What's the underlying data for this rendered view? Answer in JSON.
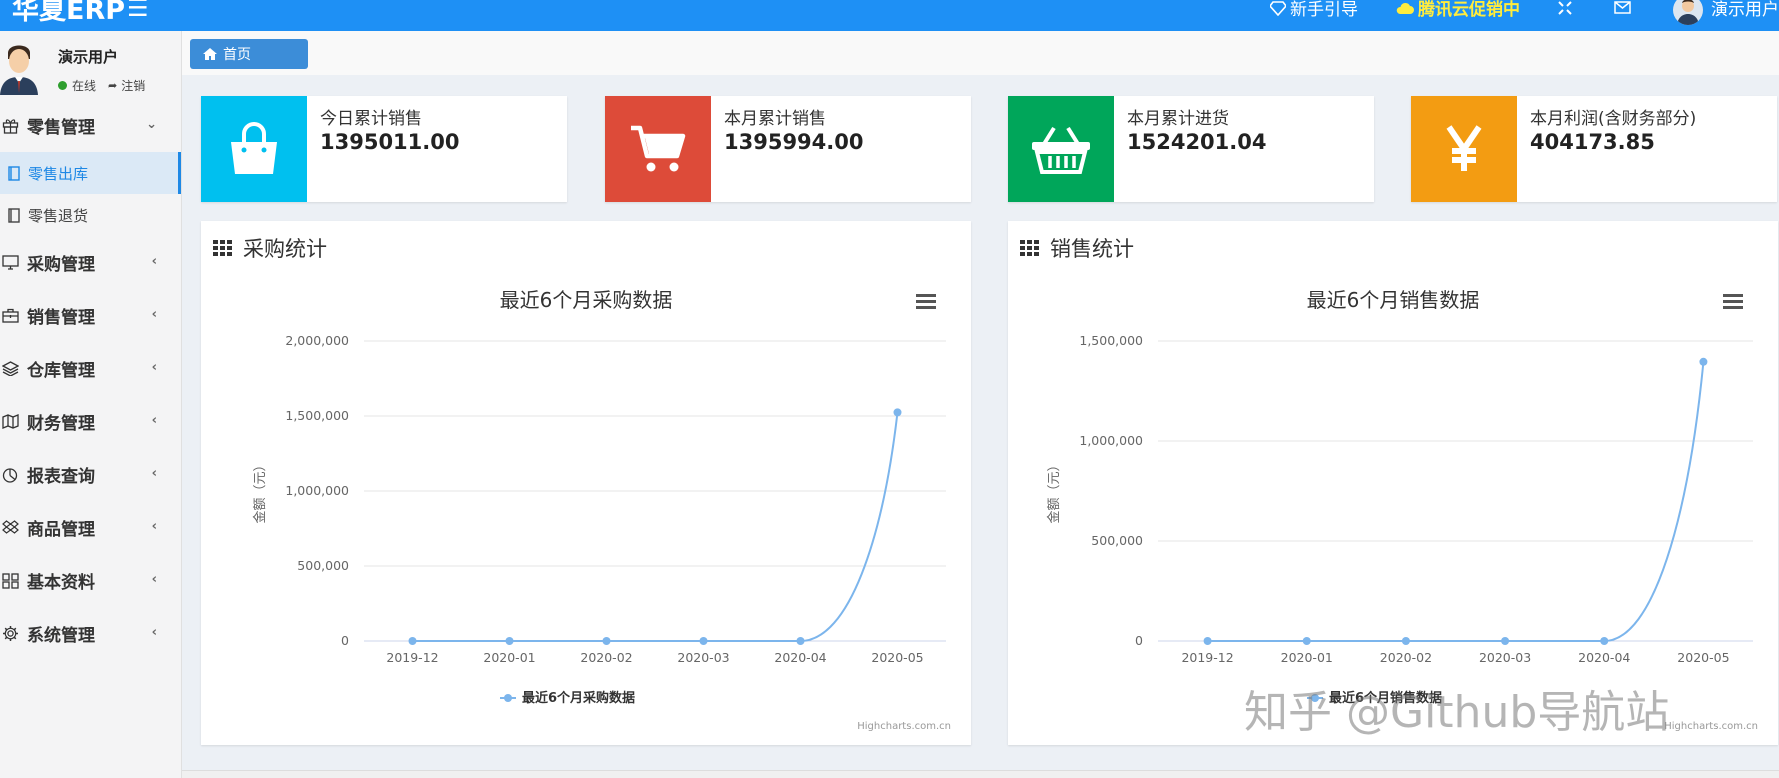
{
  "app": {
    "brand": "华夏ERP"
  },
  "topnav": {
    "guide": "新手引导",
    "promo": "腾讯云促销中",
    "username": "演示用户"
  },
  "sidebar": {
    "user": {
      "name": "演示用户",
      "status": "在线",
      "logout": "注销"
    },
    "groups": [
      {
        "label": "零售管理",
        "icon": "gift-icon",
        "expanded": true,
        "items": [
          {
            "label": "零售出库",
            "active": true
          },
          {
            "label": "零售退货",
            "active": false
          }
        ]
      },
      {
        "label": "采购管理",
        "icon": "monitor-icon"
      },
      {
        "label": "销售管理",
        "icon": "briefcase-icon"
      },
      {
        "label": "仓库管理",
        "icon": "layers-icon"
      },
      {
        "label": "财务管理",
        "icon": "map-icon"
      },
      {
        "label": "报表查询",
        "icon": "pie-chart-icon"
      },
      {
        "label": "商品管理",
        "icon": "dropbox-icon"
      },
      {
        "label": "基本资料",
        "icon": "grid-icon"
      },
      {
        "label": "系统管理",
        "icon": "gear-icon"
      }
    ]
  },
  "breadcrumb": {
    "home": "首页"
  },
  "stats": [
    {
      "label": "今日累计销售",
      "value": "1395011.00",
      "color": "#00c0ef",
      "icon": "shopping-bag-icon"
    },
    {
      "label": "本月累计销售",
      "value": "1395994.00",
      "color": "#dd4b39",
      "icon": "shopping-cart-icon"
    },
    {
      "label": "本月累计进货",
      "value": "1524201.04",
      "color": "#00a65a",
      "icon": "basket-icon"
    },
    {
      "label": "本月利润(含财务部分)",
      "value": "404173.85",
      "color": "#f39c12",
      "icon": "yen-icon"
    }
  ],
  "panels": [
    {
      "heading": "采购统计"
    },
    {
      "heading": "销售统计"
    }
  ],
  "chart_data": [
    {
      "type": "line",
      "title": "最近6个月采购数据",
      "xlabel": "",
      "ylabel": "金额（元）",
      "categories": [
        "2019-12",
        "2020-01",
        "2020-02",
        "2020-03",
        "2020-04",
        "2020-05"
      ],
      "series": [
        {
          "name": "最近6个月采购数据",
          "values": [
            0,
            0,
            0,
            0,
            0,
            1524201
          ]
        }
      ],
      "yticks": [
        "0",
        "500,000",
        "1,000,000",
        "1,500,000",
        "2,000,000"
      ],
      "ylim": [
        0,
        2000000
      ],
      "grid": true,
      "legend": "bottom-center",
      "credit": "Highcharts.com.cn",
      "color": "#7cb5ec"
    },
    {
      "type": "line",
      "title": "最近6个月销售数据",
      "xlabel": "",
      "ylabel": "金额（元）",
      "categories": [
        "2019-12",
        "2020-01",
        "2020-02",
        "2020-03",
        "2020-04",
        "2020-05"
      ],
      "series": [
        {
          "name": "最近6个月销售数据",
          "values": [
            0,
            0,
            0,
            0,
            0,
            1395994
          ]
        }
      ],
      "yticks": [
        "0",
        "500,000",
        "1,000,000",
        "1,500,000"
      ],
      "ylim": [
        0,
        1500000
      ],
      "grid": true,
      "legend": "bottom-center",
      "credit": "Highcharts.com.cn",
      "color": "#7cb5ec"
    }
  ],
  "watermark": "知乎 @Github导航站"
}
